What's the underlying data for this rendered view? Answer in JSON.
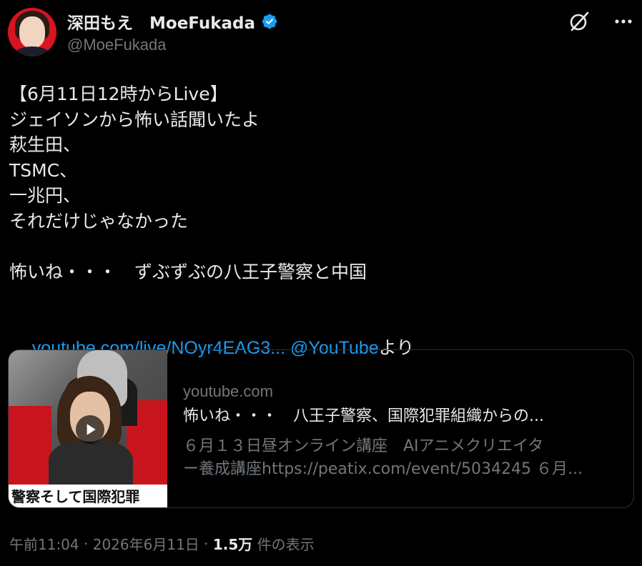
{
  "author": {
    "display_name": "深田もえ　MoeFukada",
    "handle": "@MoeFukada",
    "verified": true,
    "avatar": "profile-photo"
  },
  "header_icons": [
    "grok-slash-icon",
    "more-dots-icon"
  ],
  "tweet": {
    "lines": [
      "【6月11日12時からLive】",
      "ジェイソンから怖い話聞いたよ",
      "萩生田、",
      "TSMC、",
      "一兆円、",
      "それだけじゃなかった",
      "",
      "怖いね・・・　ずぶずぶの八王子警察と中国"
    ],
    "link_text": "youtube.com/live/NOyr4EAG3...",
    "mention_text": " @YouTube",
    "suffix_text": "より"
  },
  "card": {
    "domain": "youtube.com",
    "title": "怖いね・・・　八王子警察、国際犯罪組織からの...",
    "description_lines": [
      "６月１３日昼オンライン講座　AIアニメクリエイタ",
      "ー養成講座https://peatix.com/event/5034245 ６月..."
    ],
    "thumbnail_banner": "警察そして国際犯罪"
  },
  "meta": {
    "time": "午前11:04",
    "separator": " · ",
    "date": "2026年6月11日",
    "separator2": " · ",
    "views_count": "1.5万",
    "views_label": " 件の表示"
  },
  "colors": {
    "background": "#000000",
    "text": "#e7e9ea",
    "secondary": "#71767b",
    "link": "#1d9bf0",
    "border": "#2f3336"
  }
}
